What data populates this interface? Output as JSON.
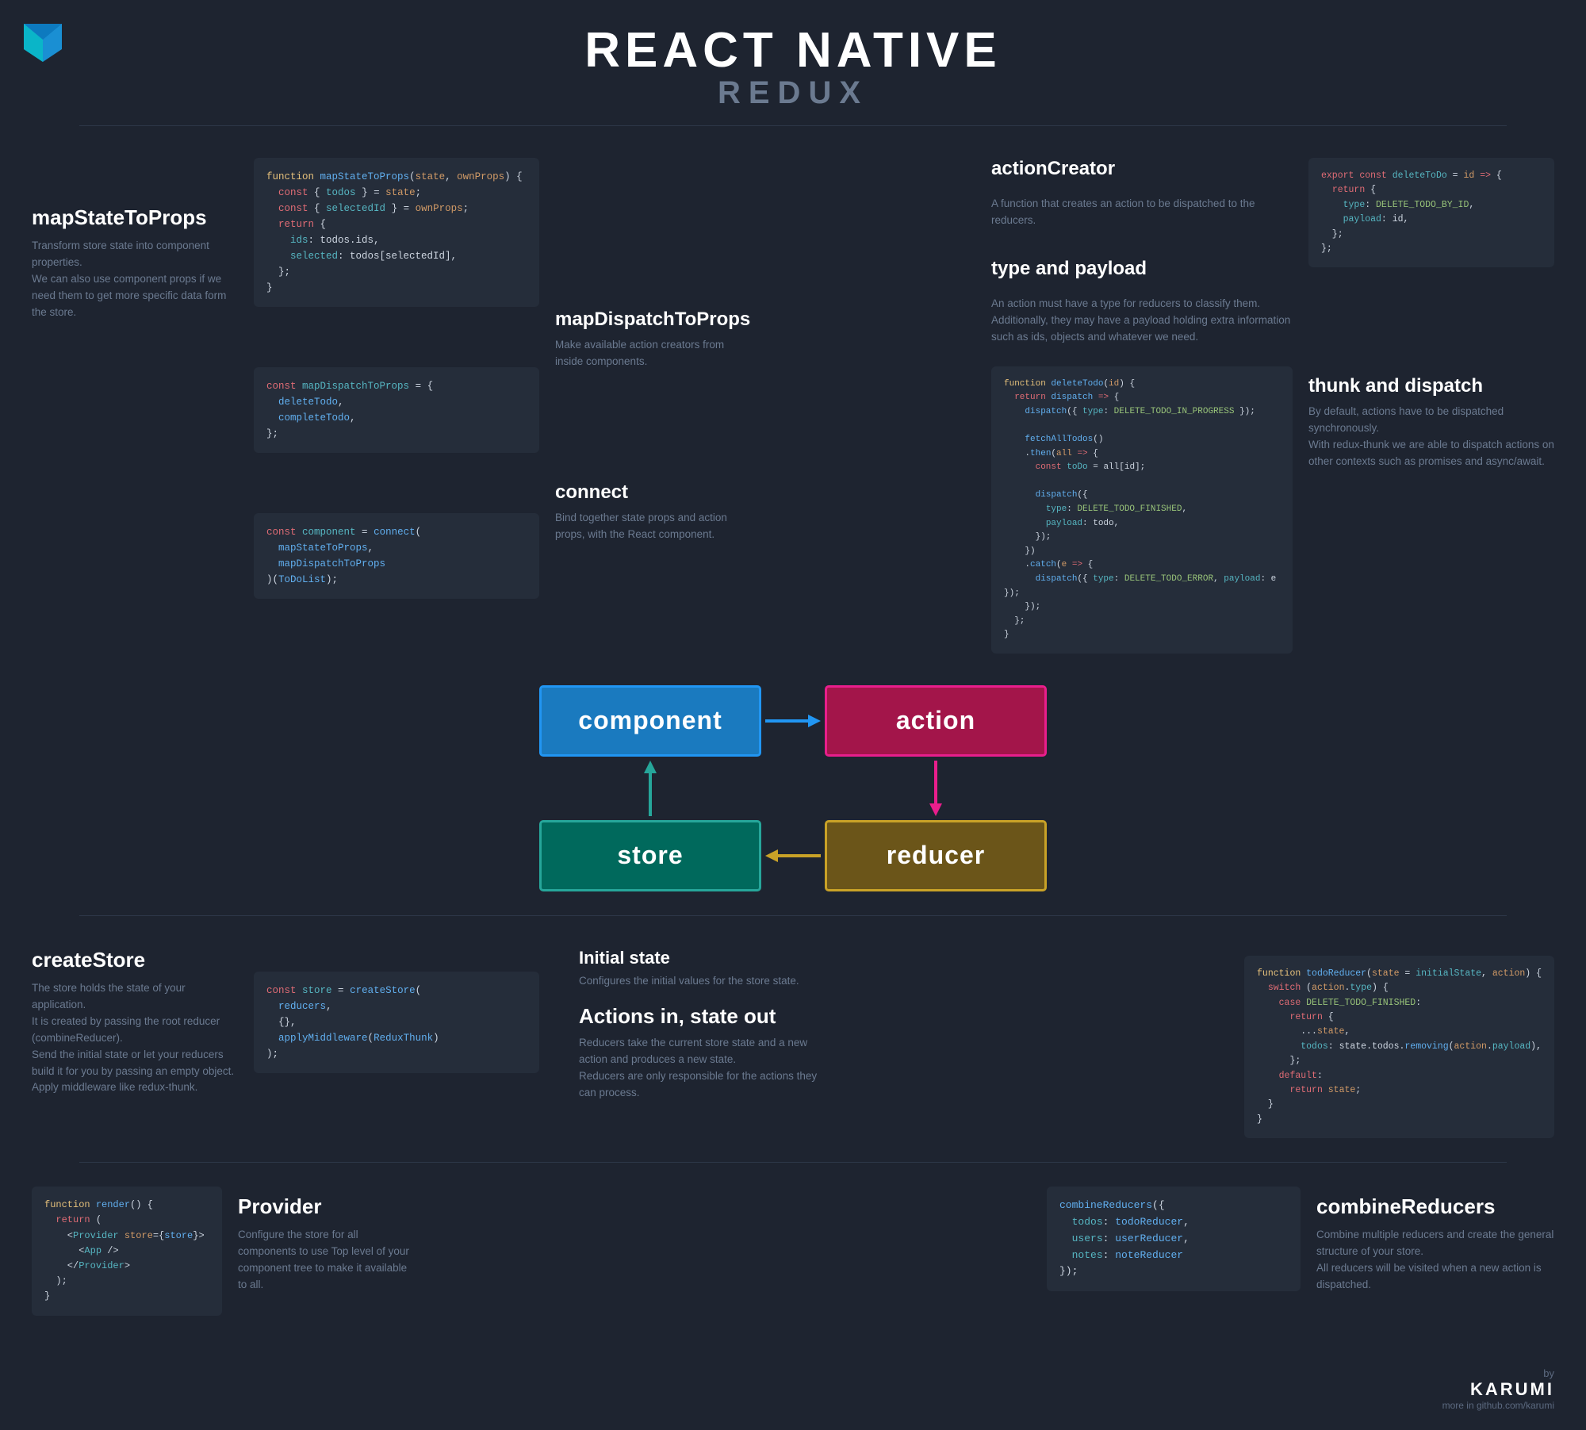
{
  "header": {
    "title_main": "REACT NATIVE",
    "title_sub": "REDUX",
    "logo_text": "▶"
  },
  "sections": {
    "mapStateToProps": {
      "title": "mapStateToProps",
      "desc": "Transform store state into component properties.\nWe can also use component props if we need them to get more specific data form the store.",
      "code": "function mapStateToProps(state, ownProps) {\n  const { todos } = state;\n  const { selectedId } = ownProps;\n  return {\n    ids: todos.ids,\n    selected: todos[selectedId],\n  };\n}"
    },
    "mapDispatchToProps": {
      "title": "mapDispatchToProps",
      "desc": "Make available action creators from inside components.",
      "code_top": "const mapDispatchToProps = {\n  deleteTodo,\n  completeTodo,\n};",
      "code_bottom": "const component = connect(\n  mapStateToProps,\n  mapDispatchToProps\n)(ToDoList);"
    },
    "connect": {
      "title": "connect",
      "desc": "Bind together state props and action props, with the React component."
    },
    "actionCreator": {
      "title": "actionCreator",
      "desc": "A function that creates an action to be dispatched to the reducers.",
      "code": "export const deleteToDo = id => {\n  return {\n    type: DELETE_TODO_BY_ID,\n    payload: id,\n  };\n};"
    },
    "typeAndPayload": {
      "title": "type and payload",
      "desc": "An action must have a type for reducers to classify them.\nAdditionally, they may have a payload holding extra information such as ids, objects and whatever we need.",
      "code": "function deleteTodo(id) {\n  return dispatch => {\n    dispatch({ type: DELETE_TODO_IN_PROGRESS });\n\n    fetchAllTodos()\n    .then(all => {\n      const toDo = all[id];\n\n      dispatch({\n        type: DELETE_TODO_FINISHED,\n        payload: todo,\n      });\n    })\n    .catch(e => {\n      dispatch({ type: DELETE_TODO_ERROR, payload: e });\n    });\n  };\n}"
    },
    "thunkAndDispatch": {
      "title": "thunk and dispatch",
      "desc": "By default, actions have to be dispatched synchronously.\nWith redux-thunk we are able to dispatch actions on other contexts such as promises and async/await."
    },
    "diagram": {
      "component_label": "component",
      "action_label": "action",
      "store_label": "store",
      "reducer_label": "reducer"
    },
    "createStore": {
      "title": "createStore",
      "desc": "The store holds the state of your application.\nIt is created by passing the root reducer (combineReducer).\nSend the initial state or let your reducers build it for you by passing an empty object.\nApply middleware like redux-thunk.",
      "code": "const store = createStore(\n  reducers,\n  {},\n  applyMiddleware(ReduxThunk)\n);"
    },
    "initialState": {
      "title": "Initial state",
      "desc": "Configures the initial values for the store state."
    },
    "actionsInStateOut": {
      "title": "Actions in, state out",
      "desc": "Reducers take the current store state and a new action and produces a new state.\nReducers are only responsible for the actions they can process.",
      "code": "function todoReducer(state = initialState, action) {\n  switch (action.type) {\n    case DELETE_TODO_FINISHED:\n      return {\n        ...state,\n        todos: state.todos.removing(action.payload),\n      };\n    default:\n      return state;\n  }\n}"
    },
    "provider": {
      "title": "Provider",
      "desc": "Configure the store for all components to use Top level of your component tree to make it available to all.",
      "code": "function render() {\n  return (\n    <Provider store={store}>\n      <App />\n    </Provider>\n  );\n}"
    },
    "combineReducers": {
      "title": "combineReducers",
      "desc": "Combine multiple reducers and create the general structure of your store.\nAll reducers will be visited when a new action is dispatched.",
      "code": "combineReducers({\n  todos: todoReducer,\n  users: userReducer,\n  notes: noteReducer\n});"
    }
  },
  "footer": {
    "by_label": "by",
    "brand": "KARUMI",
    "link": "more in github.com/karumi"
  }
}
